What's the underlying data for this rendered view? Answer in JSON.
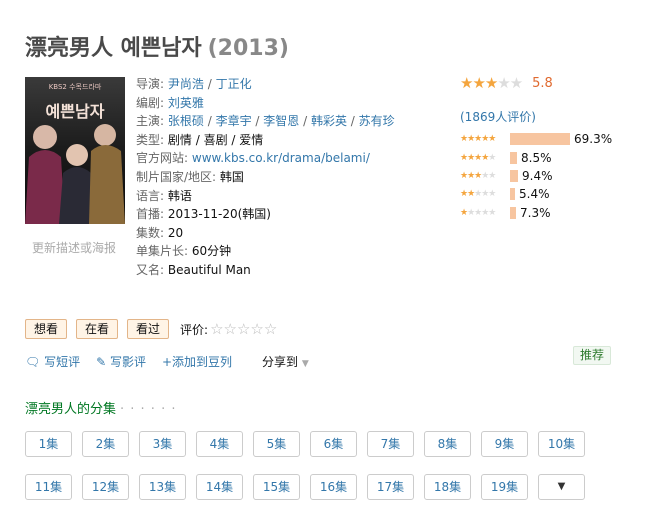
{
  "header": {
    "title": "漂亮男人 예쁜남자",
    "year": "(2013)"
  },
  "poster": {
    "change_link": "更新描述或海报",
    "logo_text": "KBS2 수목드라마",
    "title_text": "예쁜남자"
  },
  "info": {
    "director_label": "导演:",
    "directors": [
      "尹尚浩",
      "丁正化"
    ],
    "writer_label": "编剧:",
    "writers": [
      "刘英雅"
    ],
    "cast_label": "主演:",
    "cast": [
      "张根硕",
      "李章宇",
      "李智恩",
      "韩彩英",
      "苏有珍"
    ],
    "genre_label": "类型:",
    "genres": [
      "剧情",
      "喜剧",
      "爱情"
    ],
    "site_label": "官方网站:",
    "site": "www.kbs.co.kr/drama/belami/",
    "country_label": "制片国家/地区:",
    "country": "韩国",
    "language_label": "语言:",
    "language": "韩语",
    "premiere_label": "首播:",
    "premiere": "2013-11-20(韩国)",
    "episodes_label": "集数:",
    "episodes": "20",
    "runtime_label": "单集片长:",
    "runtime": "60分钟",
    "aka_label": "又名:",
    "aka": "Beautiful Man"
  },
  "rating": {
    "score": "5.8",
    "score_stars": 3,
    "count_text": "(1869人评价)",
    "distribution": [
      {
        "stars": 5,
        "pct": "69.3%",
        "value": 69.3
      },
      {
        "stars": 4,
        "pct": "8.5%",
        "value": 8.5
      },
      {
        "stars": 3,
        "pct": "9.4%",
        "value": 9.4
      },
      {
        "stars": 2,
        "pct": "5.4%",
        "value": 5.4
      },
      {
        "stars": 1,
        "pct": "7.3%",
        "value": 7.3
      }
    ],
    "colors": {
      "star_on": "#f4a53e",
      "bar": "#f7c5a0"
    }
  },
  "buttons": {
    "wish": "想看",
    "doing": "在看",
    "done": "看过",
    "rate_label": "评价:"
  },
  "actions": {
    "short_review": "写短评",
    "review": "写影评",
    "add_list": "+添加到豆列",
    "share": "分享到",
    "recommend": "推荐"
  },
  "episodes_section": {
    "title": "漂亮男人的分集",
    "dots": "· · · · · ·",
    "items": [
      "1集",
      "2集",
      "3集",
      "4集",
      "5集",
      "6集",
      "7集",
      "8集",
      "9集",
      "10集",
      "11集",
      "12集",
      "13集",
      "14集",
      "15集",
      "16集",
      "17集",
      "18集",
      "19集"
    ],
    "more": "▼"
  }
}
